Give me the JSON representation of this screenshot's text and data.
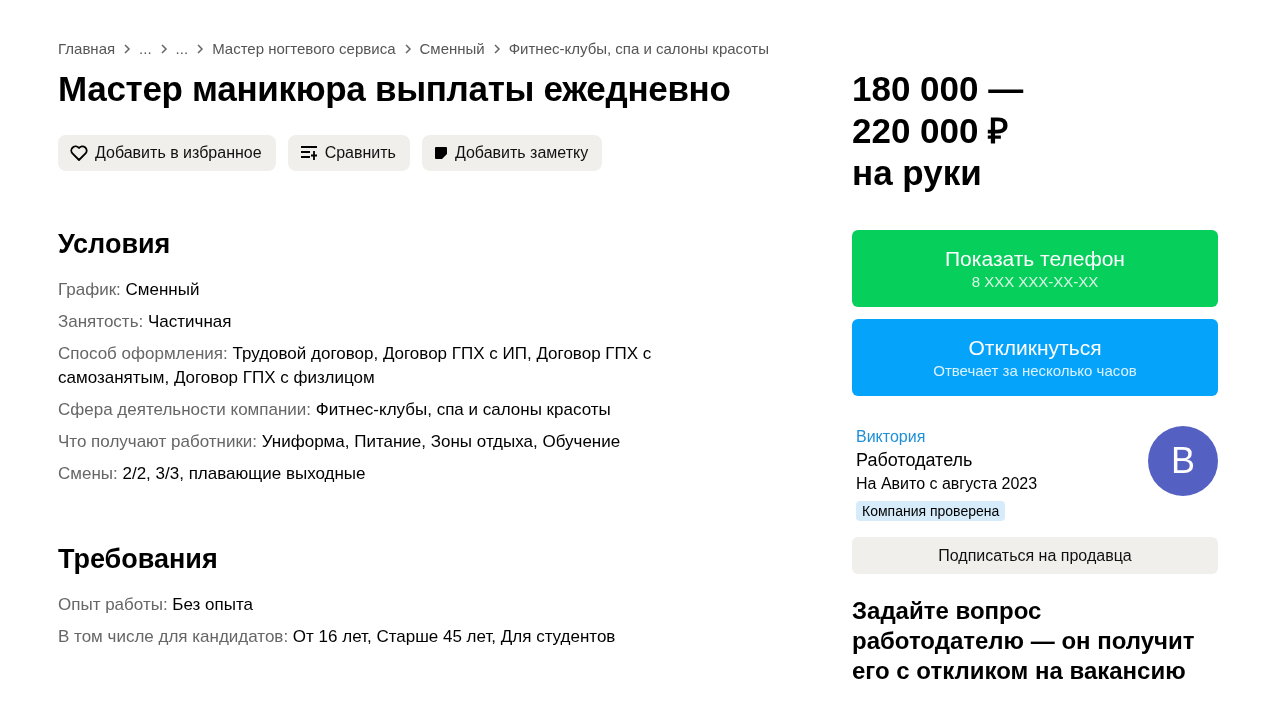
{
  "breadcrumbs": [
    "Главная",
    "...",
    "...",
    "Мастер ногтевого сервиса",
    "Сменный",
    "Фитнес-клубы, спа и салоны красоты"
  ],
  "title": "Мастер маникюра выплаты ежедневно",
  "actions": [
    {
      "kind": "heart",
      "label": "Добавить в избранное"
    },
    {
      "kind": "compare",
      "label": "Сравнить"
    },
    {
      "kind": "note",
      "label": "Добавить заметку"
    }
  ],
  "sections": [
    {
      "heading": "Условия",
      "rows": [
        {
          "label": "График:",
          "value": "Сменный"
        },
        {
          "label": "Занятость:",
          "value": "Частичная"
        },
        {
          "label": "Способ оформления:",
          "value": "Трудовой договор, Договор ГПХ с ИП, Договор ГПХ с самозанятым, Договор ГПХ с физлицом"
        },
        {
          "label": "Сфера деятельности компании:",
          "value": "Фитнес-клубы, спа и салоны красоты"
        },
        {
          "label": "Что получают работники:",
          "value": "Униформа, Питание, Зоны отдыха, Обучение"
        },
        {
          "label": "Смены:",
          "value": "2/2, 3/3, плавающие выходные"
        }
      ]
    },
    {
      "heading": "Требования",
      "rows": [
        {
          "label": "Опыт работы:",
          "value": "Без опыта"
        },
        {
          "label": "В том числе для кандидатов:",
          "value": "От 16 лет, Старше 45 лет, Для студентов"
        }
      ]
    }
  ],
  "price": {
    "lines": [
      "180 000 —",
      "220 000 ₽",
      "на руки"
    ]
  },
  "cta_buttons": [
    {
      "kind": "phone",
      "label": "Показать телефон",
      "sublabel": "8 XXX XXX-XX-XX"
    },
    {
      "kind": "respond",
      "label": "Откликнуться",
      "sublabel": "Отвечает за несколько часов"
    }
  ],
  "seller": {
    "name": "Виктория",
    "role": "Работодатель",
    "since": "На Авито с августа 2023",
    "badge": "Компания проверена",
    "avatar_letter": "В"
  },
  "subscribe_button": "Подписаться на продавца",
  "question_heading": "Задайте вопрос работодателю — он получит его с откликом на вакансию"
}
